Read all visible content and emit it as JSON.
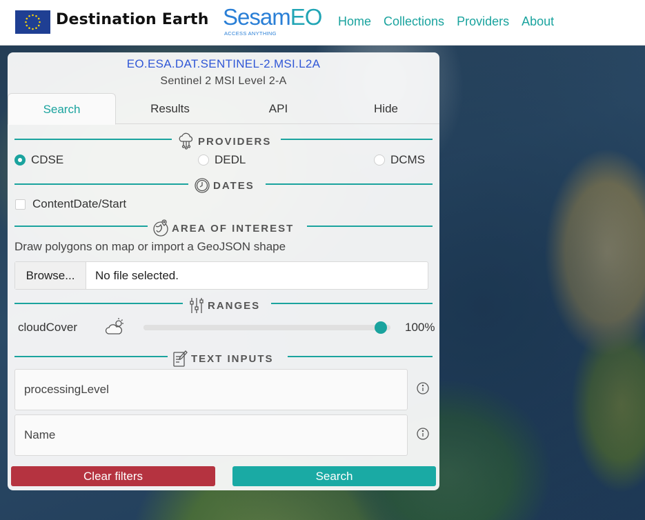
{
  "header": {
    "brand": "Destination Earth",
    "logo_main": "Sesam",
    "logo_accent": "EO",
    "logo_tagline": "ACCESS ANYTHING",
    "nav": [
      "Home",
      "Collections",
      "Providers",
      "About"
    ]
  },
  "collection": {
    "id": "EO.ESA.DAT.SENTINEL-2.MSI.L2A",
    "title": "Sentinel 2 MSI Level 2-A"
  },
  "tabs": [
    "Search",
    "Results",
    "API",
    "Hide"
  ],
  "active_tab": "Search",
  "sections": {
    "providers": "PROVIDERS",
    "dates": "DATES",
    "aoi": "AREA OF INTEREST",
    "ranges": "RANGES",
    "text_inputs": "TEXT INPUTS"
  },
  "providers": {
    "options": [
      "CDSE",
      "DEDL",
      "DCMS"
    ],
    "selected": "CDSE"
  },
  "dates": {
    "checkbox_label": "ContentDate/Start",
    "checked": false
  },
  "aoi": {
    "hint": "Draw polygons on map or import a GeoJSON shape",
    "browse_label": "Browse...",
    "file_status": "No file selected."
  },
  "ranges": {
    "label": "cloudCover",
    "value_text": "100%",
    "value": 100
  },
  "text_inputs": {
    "fields": [
      {
        "placeholder": "processingLevel"
      },
      {
        "placeholder": "Name"
      }
    ]
  },
  "buttons": {
    "clear": "Clear filters",
    "search": "Search"
  },
  "colors": {
    "accent": "#1aa39e",
    "link_blue": "#3057d6",
    "danger": "#b53340"
  },
  "icons": [
    "eu-flag",
    "cloud-network-icon",
    "clock-icon",
    "globe-pin-icon",
    "sliders-icon",
    "cloud-sun-icon",
    "notepad-icon",
    "info-icon"
  ]
}
